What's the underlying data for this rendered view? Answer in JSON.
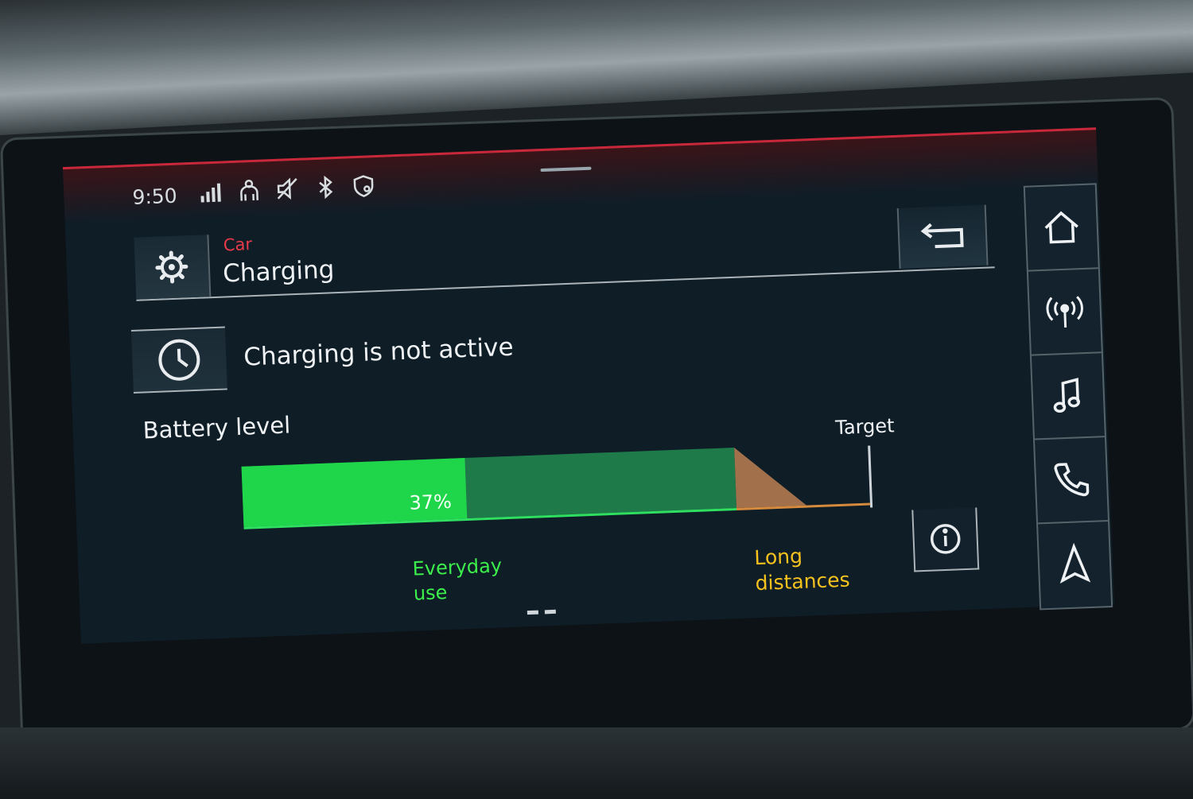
{
  "status_bar": {
    "time": "9:50",
    "icons": [
      "signal-icon",
      "passenger-icon",
      "muted-speaker-icon",
      "bluetooth-icon",
      "shield-location-icon"
    ]
  },
  "header": {
    "breadcrumb": "Car",
    "title": "Charging",
    "settings_icon": "gear-icon",
    "back_icon": "back-arrow-icon"
  },
  "charging": {
    "status_text": "Charging is not active",
    "timer_icon": "clock-icon"
  },
  "battery": {
    "section_label": "Battery level",
    "level_text": "37%",
    "level_fraction": 0.37,
    "target_label": "Target",
    "everyday_label": "Everyday use",
    "long_distance_label": "Long distances",
    "info_icon": "info-icon"
  },
  "side_nav": {
    "items": [
      "home-icon",
      "radio-icon",
      "music-icon",
      "phone-icon",
      "navigation-icon"
    ]
  },
  "colors": {
    "accent_red": "#e83a4a",
    "charge_green": "#1fd64a",
    "everyday_green": "#3cf04c",
    "long_distance_yellow": "#f5c21e",
    "screen_background": "#0f1d27"
  }
}
